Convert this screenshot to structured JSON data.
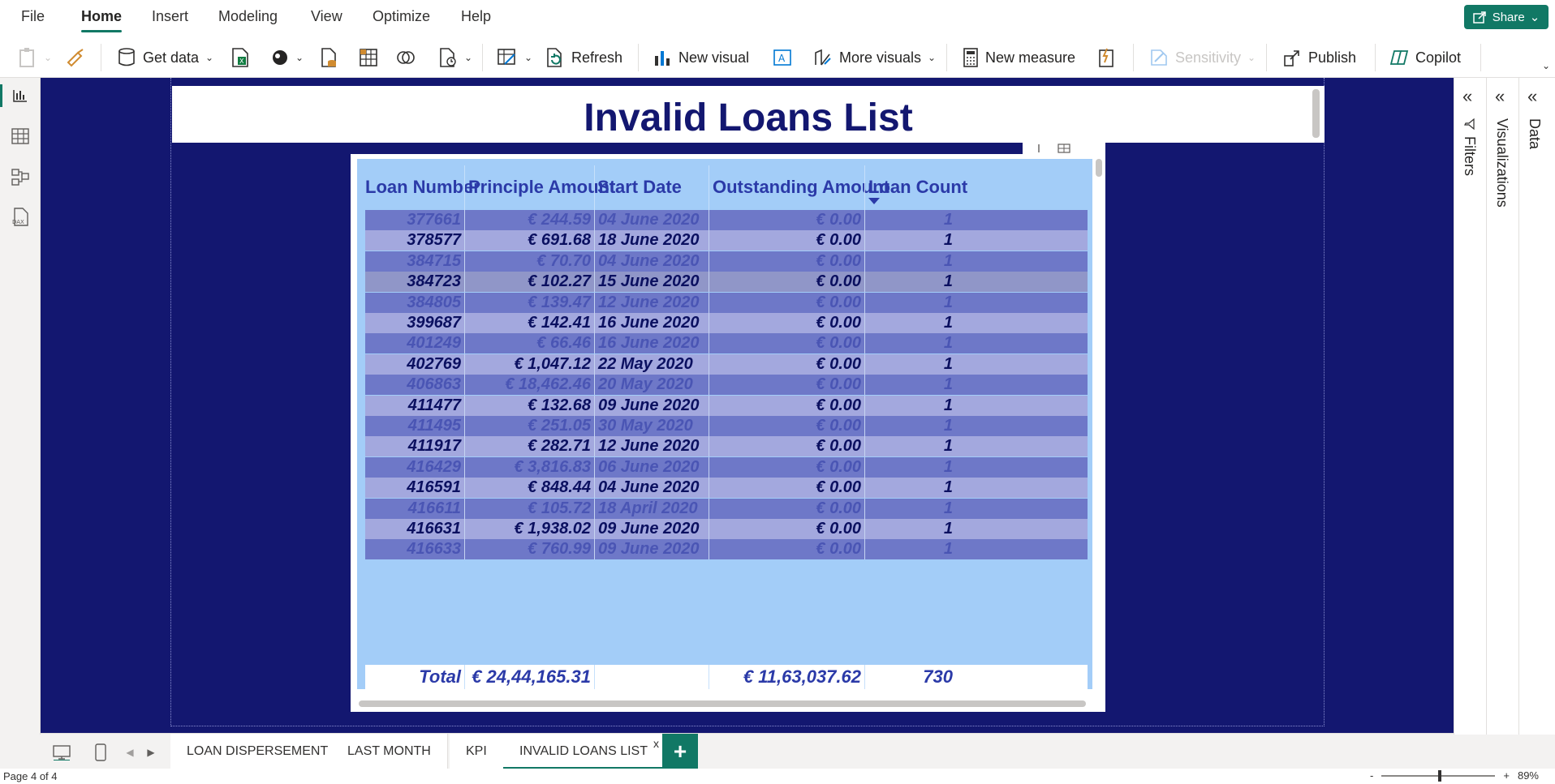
{
  "menu": {
    "items": [
      {
        "label": "File"
      },
      {
        "label": "Home"
      },
      {
        "label": "Insert"
      },
      {
        "label": "Modeling"
      },
      {
        "label": "View"
      },
      {
        "label": "Optimize"
      },
      {
        "label": "Help"
      }
    ],
    "active": "Home",
    "share_label": "Share"
  },
  "ribbon": {
    "get_data": "Get data",
    "refresh": "Refresh",
    "new_visual": "New visual",
    "more_visuals": "More visuals",
    "new_measure": "New measure",
    "sensitivity": "Sensitivity",
    "publish": "Publish",
    "copilot": "Copilot"
  },
  "report": {
    "title": "Invalid Loans List"
  },
  "table": {
    "columns": [
      "Loan Number",
      "Principle Amount",
      "Start Date",
      "Outstanding Amount",
      "Loan Count"
    ],
    "sorted_column": "Loan Count",
    "rows": [
      {
        "loan_number": "377661",
        "principle_amount": "€ 244.59",
        "start_date": "04 June 2020",
        "outstanding_amount": "€ 0.00",
        "loan_count": "1"
      },
      {
        "loan_number": "378577",
        "principle_amount": "€ 691.68",
        "start_date": "18 June 2020",
        "outstanding_amount": "€ 0.00",
        "loan_count": "1"
      },
      {
        "loan_number": "384715",
        "principle_amount": "€ 70.70",
        "start_date": "04 June 2020",
        "outstanding_amount": "€ 0.00",
        "loan_count": "1"
      },
      {
        "loan_number": "384723",
        "principle_amount": "€ 102.27",
        "start_date": "15 June 2020",
        "outstanding_amount": "€ 0.00",
        "loan_count": "1"
      },
      {
        "loan_number": "384805",
        "principle_amount": "€ 139.47",
        "start_date": "12 June 2020",
        "outstanding_amount": "€ 0.00",
        "loan_count": "1"
      },
      {
        "loan_number": "399687",
        "principle_amount": "€ 142.41",
        "start_date": "16 June 2020",
        "outstanding_amount": "€ 0.00",
        "loan_count": "1"
      },
      {
        "loan_number": "401249",
        "principle_amount": "€ 66.46",
        "start_date": "16 June 2020",
        "outstanding_amount": "€ 0.00",
        "loan_count": "1"
      },
      {
        "loan_number": "402769",
        "principle_amount": "€ 1,047.12",
        "start_date": "22 May 2020",
        "outstanding_amount": "€ 0.00",
        "loan_count": "1"
      },
      {
        "loan_number": "406863",
        "principle_amount": "€ 18,462.46",
        "start_date": "20 May 2020",
        "outstanding_amount": "€ 0.00",
        "loan_count": "1"
      },
      {
        "loan_number": "411477",
        "principle_amount": "€ 132.68",
        "start_date": "09 June 2020",
        "outstanding_amount": "€ 0.00",
        "loan_count": "1"
      },
      {
        "loan_number": "411495",
        "principle_amount": "€ 251.05",
        "start_date": "30 May 2020",
        "outstanding_amount": "€ 0.00",
        "loan_count": "1"
      },
      {
        "loan_number": "411917",
        "principle_amount": "€ 282.71",
        "start_date": "12 June 2020",
        "outstanding_amount": "€ 0.00",
        "loan_count": "1"
      },
      {
        "loan_number": "416429",
        "principle_amount": "€ 3,816.83",
        "start_date": "06 June 2020",
        "outstanding_amount": "€ 0.00",
        "loan_count": "1"
      },
      {
        "loan_number": "416591",
        "principle_amount": "€ 848.44",
        "start_date": "04 June 2020",
        "outstanding_amount": "€ 0.00",
        "loan_count": "1"
      },
      {
        "loan_number": "416611",
        "principle_amount": "€ 105.72",
        "start_date": "18 April 2020",
        "outstanding_amount": "€ 0.00",
        "loan_count": "1"
      },
      {
        "loan_number": "416631",
        "principle_amount": "€ 1,938.02",
        "start_date": "09 June 2020",
        "outstanding_amount": "€ 0.00",
        "loan_count": "1"
      },
      {
        "loan_number": "416633",
        "principle_amount": "€ 760.99",
        "start_date": "09 June 2020",
        "outstanding_amount": "€ 0.00",
        "loan_count": "1"
      }
    ],
    "total": {
      "label": "Total",
      "principle_amount": "€ 24,44,165.31",
      "start_date": "",
      "outstanding_amount": "€ 11,63,037.62",
      "loan_count": "730"
    }
  },
  "panes": {
    "filters": "Filters",
    "visualizations": "Visualizations",
    "data": "Data"
  },
  "page_tabs": {
    "tabs": [
      {
        "label": "LOAN DISPERSEMENT"
      },
      {
        "label": "LAST MONTH"
      },
      {
        "label": "KPI"
      },
      {
        "label": "INVALID LOANS LIST"
      }
    ],
    "active": "INVALID LOANS LIST",
    "close_glyph": "x",
    "add_glyph": "+"
  },
  "status": {
    "page_text": "Page 4 of 4",
    "zoom_minus": "-",
    "zoom_plus": "+",
    "zoom_level": "89%"
  },
  "colors": {
    "canvas_bg": "#131770",
    "accent": "#117865",
    "header_text": "#2b3aa8",
    "table_bg": "#a3cdf8"
  }
}
